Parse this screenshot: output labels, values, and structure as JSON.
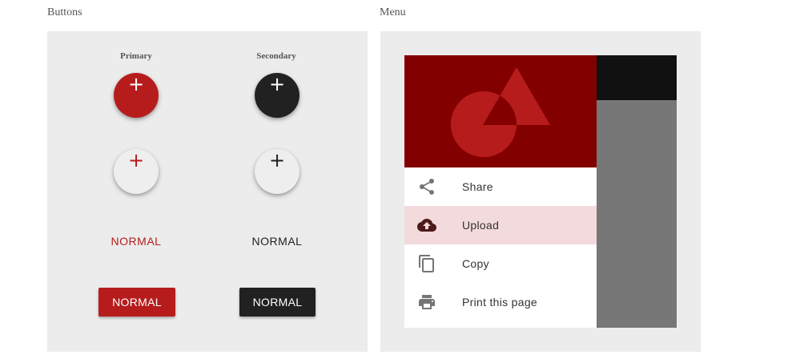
{
  "buttons_section": {
    "label": "Buttons",
    "primary_label": "Primary",
    "secondary_label": "Secondary",
    "fab_glyph": "+",
    "flat_primary": "NORMAL",
    "flat_secondary": "NORMAL",
    "raised_primary": "NORMAL",
    "raised_secondary": "NORMAL"
  },
  "menu_section": {
    "label": "Menu",
    "items": [
      {
        "label": "Share",
        "icon": "share-icon"
      },
      {
        "label": "Upload",
        "icon": "cloud-upload-icon"
      },
      {
        "label": "Copy",
        "icon": "copy-icon"
      },
      {
        "label": "Print this page",
        "icon": "print-icon"
      }
    ],
    "active_item": "Upload"
  },
  "colors": {
    "primary": "#b71c1c",
    "secondary": "#212121",
    "hero": "#830000",
    "active_item_bg": "#f3dadc",
    "panel_bg": "#ececec"
  }
}
